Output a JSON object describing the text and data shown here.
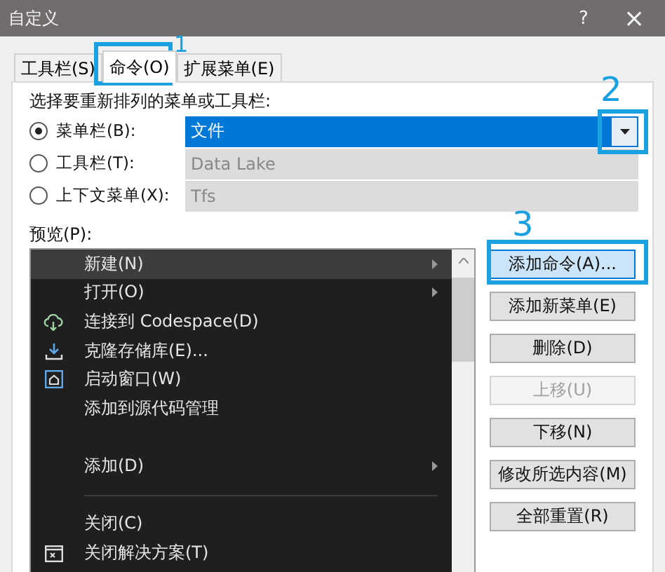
{
  "window": {
    "title": "自定义",
    "help": "?",
    "close": "×"
  },
  "tabs": [
    {
      "label": "工具栏(S)",
      "selected": false
    },
    {
      "label": "命令(O)",
      "selected": true
    },
    {
      "label": "扩展菜单(E)",
      "selected": false
    }
  ],
  "prompt": "选择要重新排列的菜单或工具栏:",
  "targets": [
    {
      "label": "菜单栏(B):",
      "selected": true,
      "value": "文件",
      "disabled": false
    },
    {
      "label": "工具栏(T):",
      "selected": false,
      "value": "Data Lake",
      "disabled": true
    },
    {
      "label": "上下文菜单(X):",
      "selected": false,
      "value": "Tfs",
      "disabled": true
    }
  ],
  "preview_label": "预览(P):",
  "menu": [
    {
      "kind": "item",
      "label": "新建(N)",
      "submenu": true,
      "selected": true
    },
    {
      "kind": "item",
      "label": "打开(O)",
      "submenu": true,
      "selected": false
    },
    {
      "kind": "item",
      "label": "连接到 Codespace(D)",
      "submenu": false,
      "selected": false
    },
    {
      "kind": "item",
      "label": "克隆存储库(E)...",
      "submenu": false,
      "selected": false
    },
    {
      "kind": "item",
      "label": "启动窗口(W)",
      "submenu": false,
      "selected": false
    },
    {
      "kind": "item",
      "label": "添加到源代码管理",
      "submenu": false,
      "selected": false
    },
    {
      "kind": "gap"
    },
    {
      "kind": "item",
      "label": "添加(D)",
      "submenu": true,
      "selected": false
    },
    {
      "kind": "separator"
    },
    {
      "kind": "item",
      "label": "关闭(C)",
      "submenu": false,
      "selected": false
    },
    {
      "kind": "item",
      "label": "关闭解决方案(T)",
      "submenu": false,
      "selected": false
    }
  ],
  "buttons": [
    {
      "label": "添加命令(A)...",
      "focused": true,
      "disabled": false
    },
    {
      "label": "添加新菜单(E)",
      "focused": false,
      "disabled": false
    },
    {
      "label": "删除(D)",
      "focused": false,
      "disabled": false
    },
    {
      "label": "上移(U)",
      "focused": false,
      "disabled": true
    },
    {
      "label": "下移(N)",
      "focused": false,
      "disabled": false
    },
    {
      "label": "修改所选内容(M)",
      "focused": false,
      "disabled": false
    },
    {
      "label": "全部重置(R)",
      "focused": false,
      "disabled": false
    }
  ],
  "annotations": [
    {
      "label": "1"
    },
    {
      "label": "2"
    },
    {
      "label": "3"
    }
  ]
}
